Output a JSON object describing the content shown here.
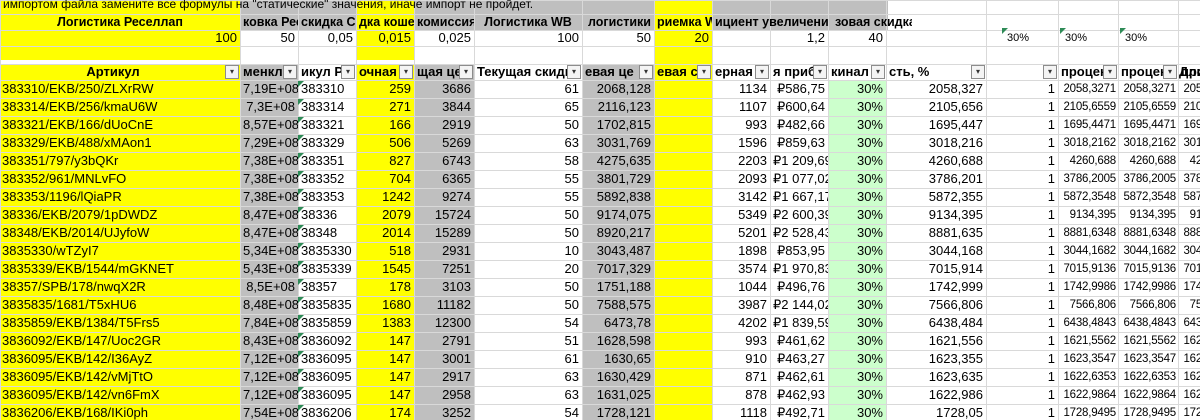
{
  "notice": "импортом файла замените все формулы на \"статические\" значения, иначе импорт не пройдет.",
  "header_row1": [
    "Логистика Реселлап",
    "ковка Ресе",
    "скидка СП",
    "дка кошел",
    "комиссия",
    "Логистика WB",
    "логистики",
    "риемка WE",
    "ициент увеличени",
    "зовая скидка"
  ],
  "params_row": [
    "100",
    "50",
    "0,05",
    "0,015",
    "0,025",
    "100",
    "50",
    "20",
    "1,2",
    "40",
    "30%",
    "30%",
    "30%"
  ],
  "col_headers": [
    "Артикул",
    "менкла",
    "икул Ре",
    "очная ц",
    "щая це",
    "Текущая скидка,",
    "евая це",
    "евая ск",
    "ерная ц",
    "я прибы",
    "кинал",
    "сть, %",
    "",
    "процен",
    "процен",
    "процен",
    "Дли"
  ],
  "colors": {
    "yellow": "#ffff00",
    "gray": "#bfbfbf",
    "light_green": "#ccffcc",
    "marker_green": "#2e8b57"
  },
  "rows": [
    [
      "383310/EKB/250/ZLXrRW",
      "7,19E+08",
      "383310",
      "259",
      "3686",
      "61",
      "2068,128",
      "",
      "1134",
      "₽586,75",
      "30%",
      "2058,327",
      "1",
      "2058,3271",
      "2058,3271",
      "2058,3271"
    ],
    [
      "383314/EKB/256/kmaU6W",
      "7,3E+08",
      "383314",
      "271",
      "3844",
      "65",
      "2116,123",
      "",
      "1107",
      "₽600,64",
      "30%",
      "2105,656",
      "1",
      "2105,6559",
      "2105,6559",
      "2105,6559"
    ],
    [
      "383321/EKB/166/dUoCnE",
      "8,57E+08",
      "383321",
      "166",
      "2919",
      "50",
      "1702,815",
      "",
      "993",
      "₽482,66",
      "30%",
      "1695,447",
      "1",
      "1695,4471",
      "1695,4471",
      "1695,4471"
    ],
    [
      "383329/EKB/488/xMAon1",
      "7,29E+08",
      "383329",
      "506",
      "5269",
      "63",
      "3031,769",
      "",
      "1596",
      "₽859,63",
      "30%",
      "3018,216",
      "1",
      "3018,2162",
      "3018,2162",
      "3018,2162"
    ],
    [
      "383351/797/y3bQKr",
      "7,38E+08",
      "383351",
      "827",
      "6743",
      "58",
      "4275,635",
      "",
      "2203",
      "₽1 209,69",
      "30%",
      "4260,688",
      "1",
      "4260,688",
      "4260,688",
      "4260,688"
    ],
    [
      "383352/961/MNLvFO",
      "7,38E+08",
      "383352",
      "704",
      "6365",
      "55",
      "3801,729",
      "",
      "2093",
      "₽1 077,02",
      "30%",
      "3786,201",
      "1",
      "3786,2005",
      "3786,2005",
      "3786,2005"
    ],
    [
      "383353/1196/lQiaPR",
      "7,38E+08",
      "383353",
      "1242",
      "9274",
      "55",
      "5892,838",
      "",
      "3142",
      "₽1 667,17",
      "30%",
      "5872,355",
      "1",
      "5872,3548",
      "5872,3548",
      "5872,3548"
    ],
    [
      "38336/EKB/2079/1pDWDZ",
      "8,47E+08",
      "38336",
      "2079",
      "15724",
      "50",
      "9174,075",
      "",
      "5349",
      "₽2 600,39",
      "30%",
      "9134,395",
      "1",
      "9134,395",
      "9134,395",
      "9134,395"
    ],
    [
      "38348/EKB/2014/UJyfoW",
      "8,47E+08",
      "38348",
      "2014",
      "15289",
      "50",
      "8920,217",
      "",
      "5201",
      "₽2 528,43",
      "30%",
      "8881,635",
      "1",
      "8881,6348",
      "8881,6348",
      "8881,6348"
    ],
    [
      "3835330/wTZyI7",
      "5,34E+08",
      "3835330",
      "518",
      "2931",
      "10",
      "3043,487",
      "",
      "1898",
      "₽853,95",
      "30%",
      "3044,168",
      "1",
      "3044,1682",
      "3044,1682",
      "3044,1682"
    ],
    [
      "3835339/EKB/1544/mGKNET",
      "5,43E+08",
      "3835339",
      "1545",
      "7251",
      "20",
      "7017,329",
      "",
      "3574",
      "₽1 970,83",
      "30%",
      "7015,914",
      "1",
      "7015,9136",
      "7015,9136",
      "7015,9136"
    ],
    [
      "38357/SPB/178/nwqX2R",
      "8,5E+08",
      "38357",
      "178",
      "3103",
      "50",
      "1751,188",
      "",
      "1044",
      "₽496,76",
      "30%",
      "1742,999",
      "1",
      "1742,9986",
      "1742,9986",
      "1742,9986"
    ],
    [
      "3835835/1681/T5xHU6",
      "8,48E+08",
      "3835835",
      "1680",
      "11182",
      "50",
      "7588,575",
      "",
      "3987",
      "₽2 144,02",
      "30%",
      "7566,806",
      "1",
      "7566,806",
      "7566,806",
      "7566,806"
    ],
    [
      "3835859/EKB/1384/T5Frs5",
      "7,84E+08",
      "3835859",
      "1383",
      "12300",
      "54",
      "6473,78",
      "",
      "4202",
      "₽1 839,59",
      "30%",
      "6438,484",
      "1",
      "6438,4843",
      "6438,4843",
      "6438,4843"
    ],
    [
      "3836092/EKB/147/Uoc2GR",
      "8,43E+08",
      "3836092",
      "147",
      "2791",
      "51",
      "1628,598",
      "",
      "993",
      "₽461,62",
      "30%",
      "1621,556",
      "1",
      "1621,5562",
      "1621,5562",
      "1621,5562"
    ],
    [
      "3836095/EKB/142/I36AyZ",
      "7,12E+08",
      "3836095",
      "147",
      "3001",
      "61",
      "1630,65",
      "",
      "910",
      "₽463,27",
      "30%",
      "1623,355",
      "1",
      "1623,3547",
      "1623,3547",
      "1623,3547"
    ],
    [
      "3836095/EKB/142/vMjTtO",
      "7,12E+08",
      "3836095",
      "147",
      "2917",
      "63",
      "1630,429",
      "",
      "871",
      "₽462,61",
      "30%",
      "1623,635",
      "1",
      "1622,6353",
      "1622,6353",
      "1622,6353"
    ],
    [
      "3836095/EKB/142/vn6FmX",
      "7,12E+08",
      "3836095",
      "147",
      "2958",
      "63",
      "1631,025",
      "",
      "878",
      "₽462,93",
      "30%",
      "1622,986",
      "1",
      "1622,9864",
      "1622,9864",
      "1622,9864"
    ],
    [
      "3836206/EKB/168/IKi0ph",
      "7,54E+08",
      "3836206",
      "174",
      "3252",
      "54",
      "1728,121",
      "",
      "1118",
      "₽492,71",
      "30%",
      "1728,05",
      "1",
      "1728,9495",
      "1728,9495",
      "1728,9495"
    ]
  ]
}
